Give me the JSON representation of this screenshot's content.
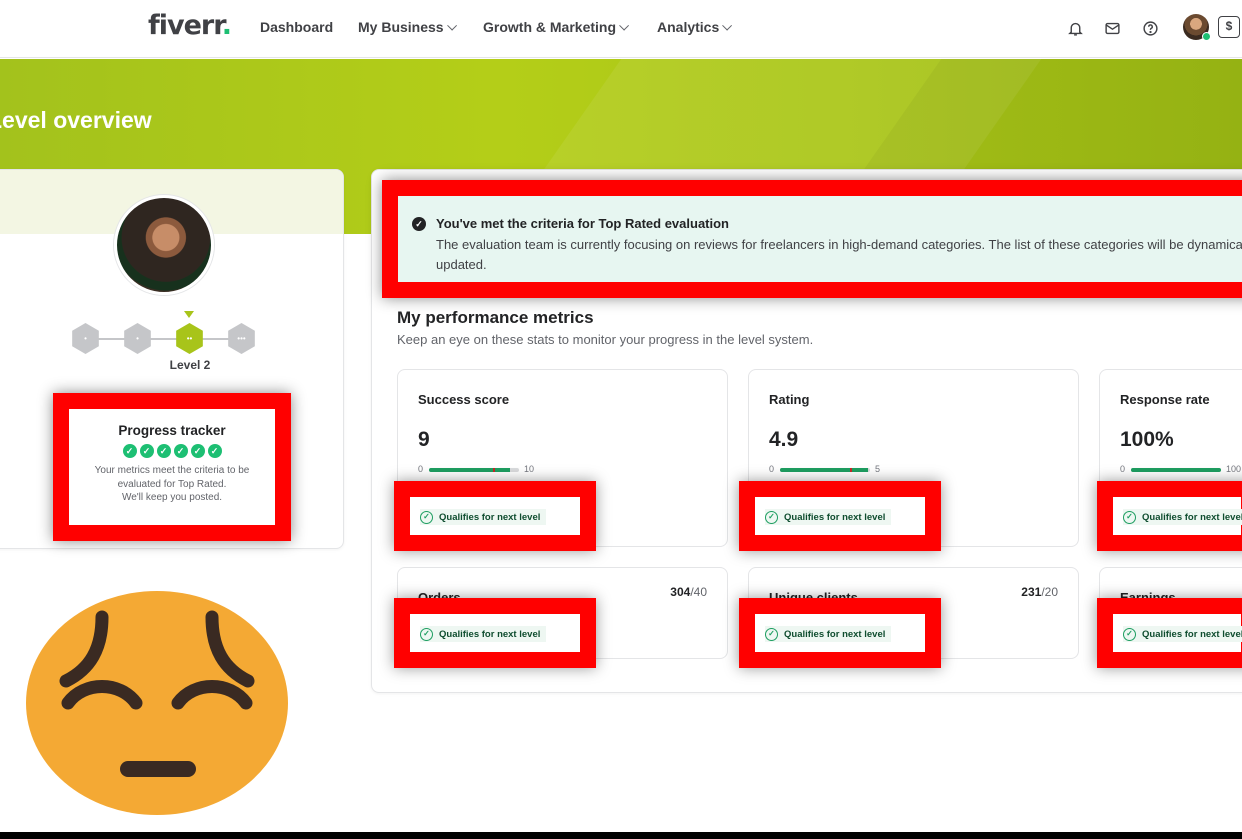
{
  "nav": {
    "logo": "fiverr",
    "logo_dot": ".",
    "items": [
      "Dashboard",
      "My Business",
      "Growth & Marketing",
      "Analytics"
    ],
    "icons": [
      "bell-icon",
      "mail-icon",
      "help-icon"
    ],
    "switch_label": "$"
  },
  "hero": {
    "title": "Level overview"
  },
  "profile": {
    "level_label": "Level 2",
    "level_index": 3,
    "levels_total": 4
  },
  "progress_tracker": {
    "title": "Progress tracker",
    "checks_met": 6,
    "text_line1": "Your metrics meet the criteria to be",
    "text_line2": "evaluated for Top Rated.",
    "text_line3": "We'll keep you posted."
  },
  "alert": {
    "title": "You've met the criteria for Top Rated evaluation",
    "body": "The evaluation team is currently focusing on reviews for freelancers in high-demand categories. The list of these categories will be dynamically updated."
  },
  "metrics_section": {
    "title": "My performance metrics",
    "subtitle": "Keep an eye on these stats to monitor your progress in the level system."
  },
  "qualify_label": "Qualifies for next level",
  "metrics": [
    {
      "name": "Success score",
      "value": "9",
      "min": "0",
      "max": "10",
      "fill": 0.9
    },
    {
      "name": "Rating",
      "value": "4.9",
      "min": "0",
      "max": "5",
      "fill": 0.98
    },
    {
      "name": "Response rate",
      "value": "100%",
      "min": "0",
      "max": "100",
      "fill": 1.0
    }
  ],
  "counters": [
    {
      "name": "Orders",
      "current": "304",
      "target": "/40"
    },
    {
      "name": "Unique clients",
      "current": "231",
      "target": "/20"
    },
    {
      "name": "Earnings",
      "current": "",
      "target": ""
    }
  ],
  "colors": {
    "brand_green": "#1dbf73",
    "level_lime": "#a8c41a",
    "highlight_red": "#ff0000"
  }
}
